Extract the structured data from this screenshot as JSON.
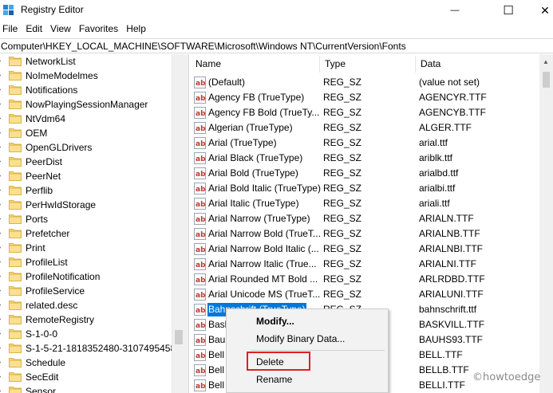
{
  "window": {
    "title": "Registry Editor",
    "controls": {
      "minimize": "—",
      "maximize": "☐",
      "close": "✕"
    }
  },
  "menu": [
    "File",
    "Edit",
    "View",
    "Favorites",
    "Help"
  ],
  "address": "Computer\\HKEY_LOCAL_MACHINE\\SOFTWARE\\Microsoft\\Windows NT\\CurrentVersion\\Fonts",
  "tree": {
    "items": [
      "NetworkList",
      "NoImeModelmes",
      "Notifications",
      "NowPlayingSessionManager",
      "NtVdm64",
      "OEM",
      "OpenGLDrivers",
      "PeerDist",
      "PeerNet",
      "Perflib",
      "PerHwIdStorage",
      "Ports",
      "Prefetcher",
      "Print",
      "ProfileList",
      "ProfileNotification",
      "ProfileService",
      "related.desc",
      "RemoteRegistry",
      "S-1-0-0",
      "S-1-5-21-1818352480-3107495458-2",
      "Schedule",
      "SecEdit",
      "Sensor"
    ]
  },
  "list": {
    "columns": {
      "name": "Name",
      "type": "Type",
      "data": "Data"
    },
    "rows": [
      {
        "name": "(Default)",
        "type": "REG_SZ",
        "data": "(value not set)"
      },
      {
        "name": "Agency FB (TrueType)",
        "type": "REG_SZ",
        "data": "AGENCYR.TTF"
      },
      {
        "name": "Agency FB Bold (TrueTy...",
        "type": "REG_SZ",
        "data": "AGENCYB.TTF"
      },
      {
        "name": "Algerian (TrueType)",
        "type": "REG_SZ",
        "data": "ALGER.TTF"
      },
      {
        "name": "Arial (TrueType)",
        "type": "REG_SZ",
        "data": "arial.ttf"
      },
      {
        "name": "Arial Black (TrueType)",
        "type": "REG_SZ",
        "data": "ariblk.ttf"
      },
      {
        "name": "Arial Bold (TrueType)",
        "type": "REG_SZ",
        "data": "arialbd.ttf"
      },
      {
        "name": "Arial Bold Italic (TrueType)",
        "type": "REG_SZ",
        "data": "arialbi.ttf"
      },
      {
        "name": "Arial Italic (TrueType)",
        "type": "REG_SZ",
        "data": "ariali.ttf"
      },
      {
        "name": "Arial Narrow (TrueType)",
        "type": "REG_SZ",
        "data": "ARIALN.TTF"
      },
      {
        "name": "Arial Narrow Bold (TrueT...",
        "type": "REG_SZ",
        "data": "ARIALNB.TTF"
      },
      {
        "name": "Arial Narrow Bold Italic (...",
        "type": "REG_SZ",
        "data": "ARIALNBI.TTF"
      },
      {
        "name": "Arial Narrow Italic (True...",
        "type": "REG_SZ",
        "data": "ARIALNI.TTF"
      },
      {
        "name": "Arial Rounded MT Bold ...",
        "type": "REG_SZ",
        "data": "ARLRDBD.TTF"
      },
      {
        "name": "Arial Unicode MS (TrueT...",
        "type": "REG_SZ",
        "data": "ARIALUNI.TTF"
      },
      {
        "name": "Bahnschrift (TrueType)",
        "type": "REG_SZ",
        "data": "bahnschrift.ttf",
        "selected": true
      },
      {
        "name": "Bask",
        "type": "",
        "data": "BASKVILL.TTF"
      },
      {
        "name": "Bauh",
        "type": "",
        "data": "BAUHS93.TTF"
      },
      {
        "name": "Bell M",
        "type": "",
        "data": "BELL.TTF"
      },
      {
        "name": "Bell M",
        "type": "",
        "data": "BELLB.TTF"
      },
      {
        "name": "Bell M",
        "type": "",
        "data": "BELLI.TTF"
      }
    ]
  },
  "context_menu": {
    "modify": "Modify...",
    "modify_binary": "Modify Binary Data...",
    "delete": "Delete",
    "rename": "Rename"
  },
  "watermark": "©howtoedge",
  "colors": {
    "selection": "#0078d7",
    "folder": "#f8d775",
    "highlight_box": "#e02020"
  }
}
